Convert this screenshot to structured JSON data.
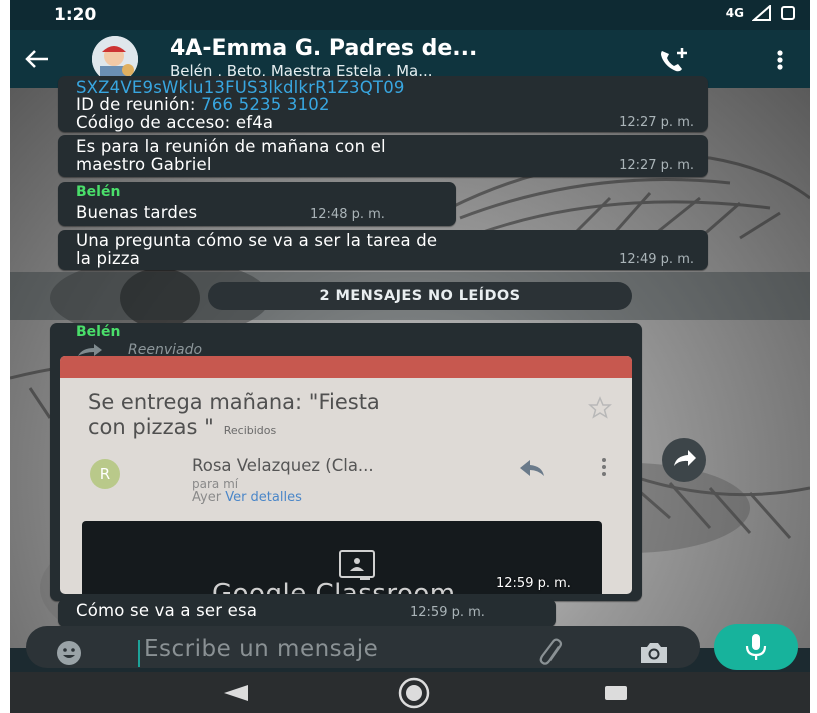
{
  "status_bar": {
    "time": "1:20",
    "network": "4G"
  },
  "header": {
    "title": "4A-Emma G. Padres de...",
    "subtitle": "Belén , Beto, Maestra Estela , Ma..."
  },
  "messages": [
    {
      "id": "zoom",
      "link_line": "SXZ4VE9sWklu13FUS3lkdlkrR1Z3QT09",
      "meeting_label": "ID de reunión: ",
      "meeting_id": "766 5235 3102",
      "passcode": "Código de acceso: ef4a",
      "time": "12:27 p. m."
    },
    {
      "id": "reunion",
      "line1": "Es para la reunión de mañana con el",
      "line2": "maestro Gabriel",
      "time": "12:27 p. m."
    },
    {
      "id": "tardes",
      "sender": "Belén",
      "text": "Buenas tardes",
      "time": "12:48 p. m."
    },
    {
      "id": "pregunta",
      "line1": "Una pregunta cómo se va a ser la tarea de",
      "line2": "la pizza",
      "time": "12:49 p. m."
    },
    {
      "id": "forwarded",
      "sender": "Belén",
      "forwarded_label": "Reenviado",
      "time": "12:59 p. m."
    },
    {
      "id": "esa",
      "text": "Cómo se va a ser esa",
      "time": "12:59 p. m."
    }
  ],
  "unread_banner": "2 MENSAJES NO LEÍDOS",
  "forwarded_photo": {
    "subject_line1": "Se entrega mañana: \"Fiesta",
    "subject_line2": "con pizzas \"",
    "label": "Recibidos",
    "avatar_letter": "R",
    "from": "Rosa Velazquez (Cla...",
    "to": "para mí",
    "date": "Ayer",
    "details_link": "Ver detalles",
    "card_text": "Google Classroom"
  },
  "input": {
    "placeholder": "Escribe un mensaje"
  },
  "colors": {
    "header": "#0f343e",
    "bubble": "#252d31",
    "accent": "#17b39c",
    "sender": "#4ade6a",
    "link": "#38a6e0"
  }
}
